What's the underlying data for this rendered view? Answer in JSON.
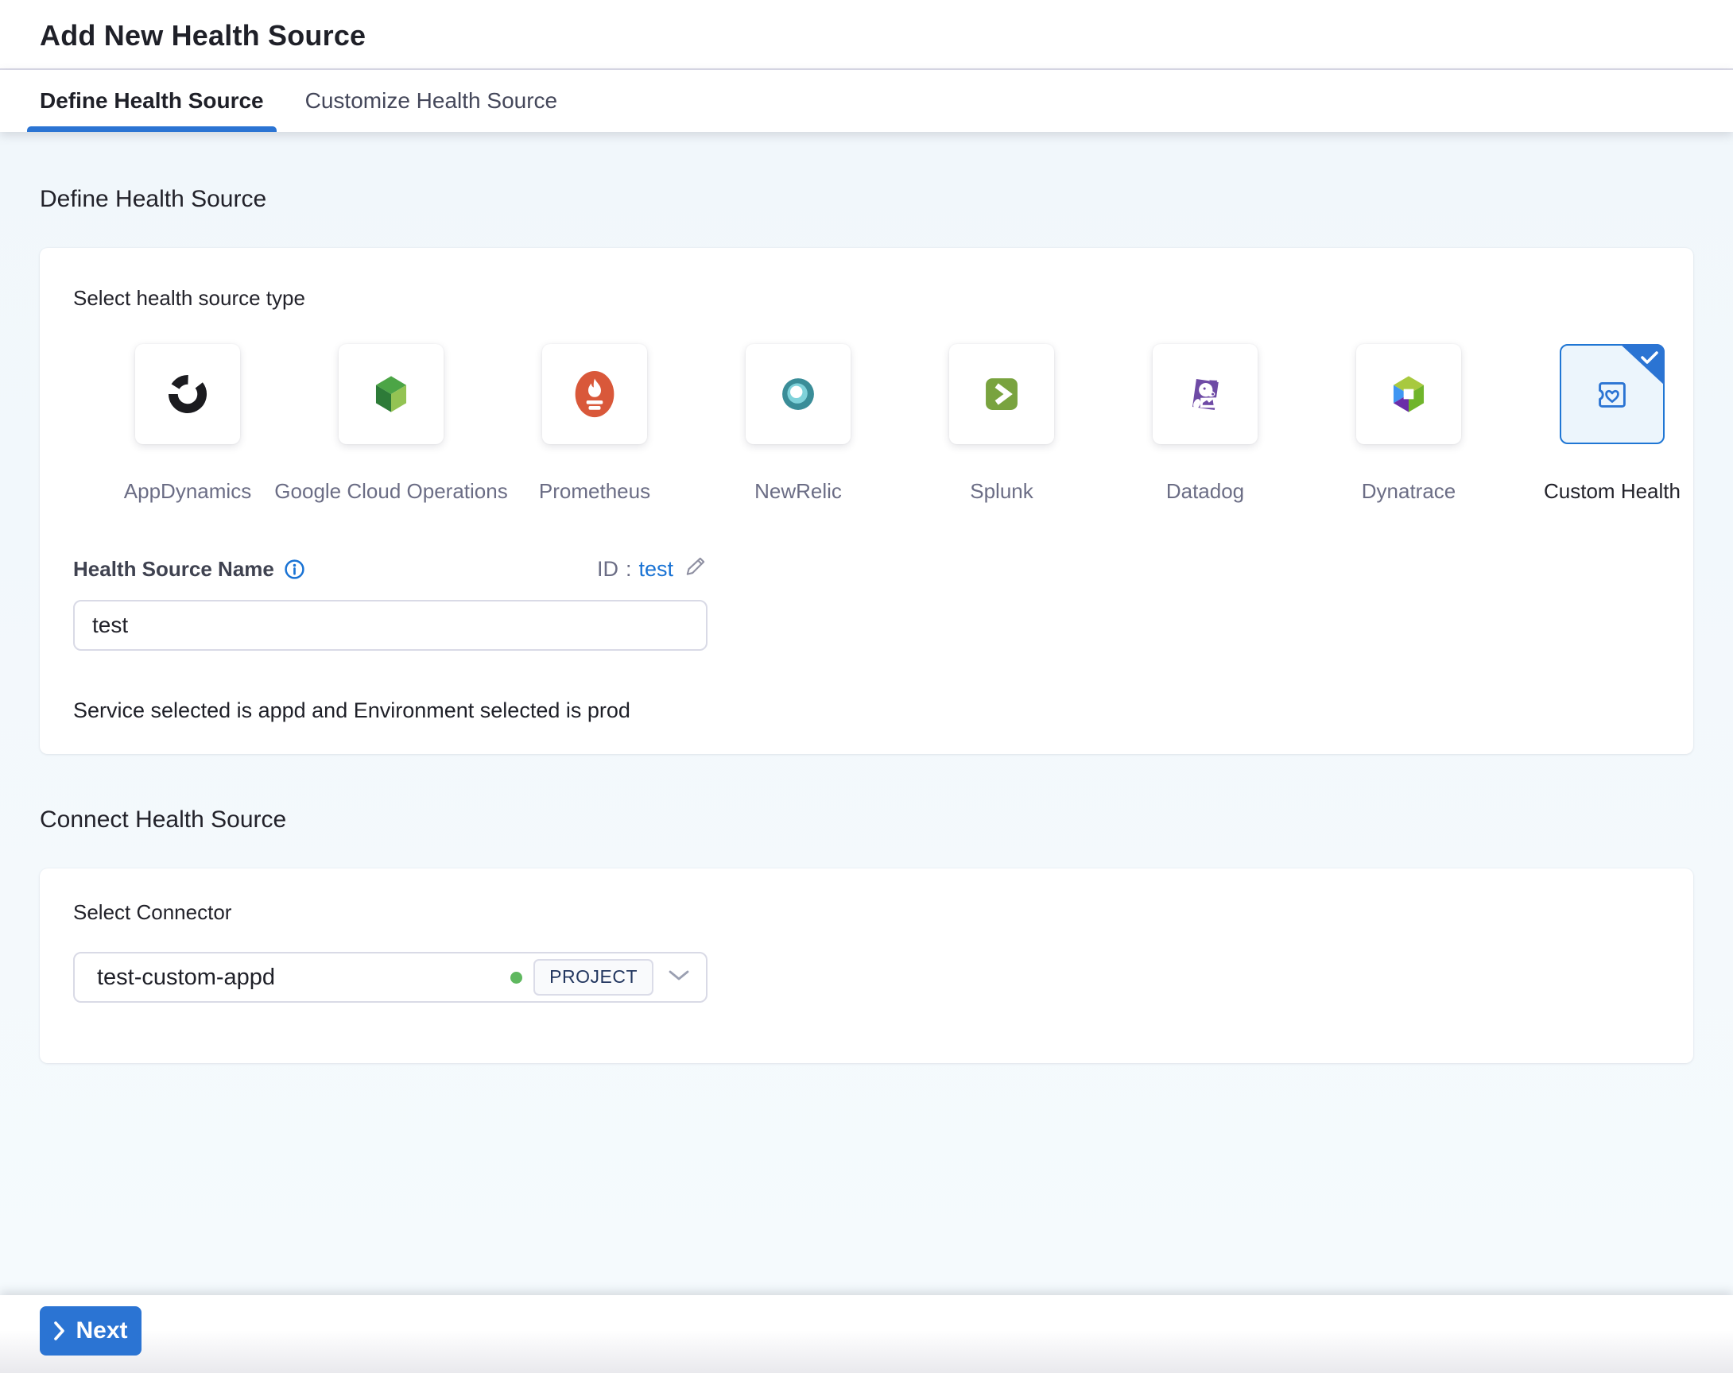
{
  "window": {
    "title": "Add New Health Source"
  },
  "tabs": {
    "items": [
      {
        "label": "Define Health Source",
        "active": true
      },
      {
        "label": "Customize Health Source",
        "active": false
      }
    ]
  },
  "define": {
    "heading": "Define Health Source",
    "type_label": "Select health source type",
    "sources": [
      {
        "label": "AppDynamics",
        "icon": "appdynamics-logo",
        "selected": false
      },
      {
        "label": "Google Cloud Operations",
        "icon": "google-cloud-operations-logo",
        "selected": false
      },
      {
        "label": "Prometheus",
        "icon": "prometheus-logo",
        "selected": false
      },
      {
        "label": "NewRelic",
        "icon": "newrelic-logo",
        "selected": false
      },
      {
        "label": "Splunk",
        "icon": "splunk-logo",
        "selected": false
      },
      {
        "label": "Datadog",
        "icon": "datadog-logo",
        "selected": false
      },
      {
        "label": "Dynatrace",
        "icon": "dynatrace-logo",
        "selected": false
      },
      {
        "label": "Custom Health",
        "icon": "custom-health-logo",
        "selected": true
      }
    ],
    "name_field": {
      "label": "Health Source Name",
      "value": "test"
    },
    "id_field": {
      "label": "ID",
      "separator": ":",
      "value": "test"
    },
    "service_env_text": "Service selected is appd and Environment selected is prod"
  },
  "connect": {
    "heading": "Connect Health Source",
    "connector_label": "Select Connector",
    "connector": {
      "value": "test-custom-appd",
      "scope_badge": "PROJECT"
    }
  },
  "footer": {
    "next_label": "Next"
  },
  "colors": {
    "primary_blue": "#2b74d3",
    "link_blue": "#1a73d4",
    "selected_tile_bg": "#ecf5fc",
    "content_bg": "#f2f8fb",
    "muted_label": "#6b6d85",
    "text_dark": "#22222a",
    "badge_text": "#22365f",
    "status_green": "#5fb85f"
  }
}
